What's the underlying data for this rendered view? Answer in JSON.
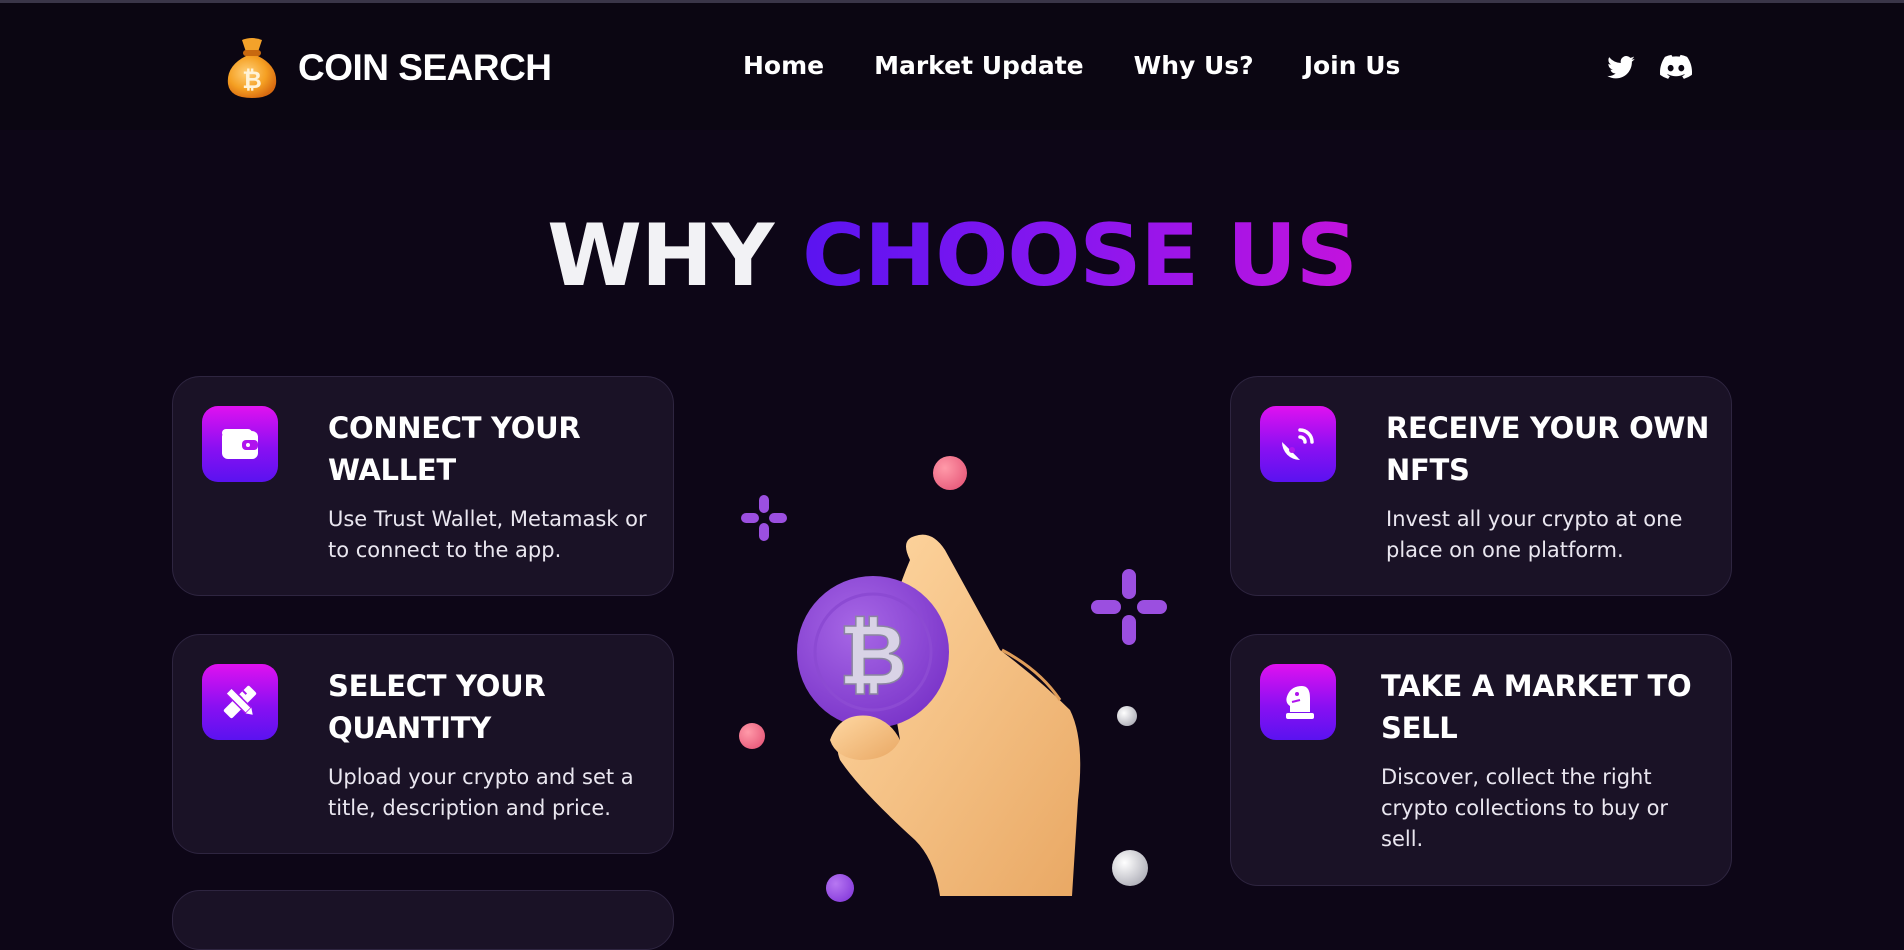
{
  "brand": {
    "name": "COIN SEARCH",
    "logo_icon": "bitcoin-money-bag-icon"
  },
  "nav": {
    "items": [
      "Home",
      "Market Update",
      "Why Us?",
      "Join Us"
    ]
  },
  "socials": {
    "twitter_icon": "twitter-icon",
    "discord_icon": "discord-icon"
  },
  "section": {
    "title_part1": "WHY",
    "title_part2": "CHOOSE US"
  },
  "features": [
    {
      "icon": "wallet-icon",
      "title": "CONNECT YOUR WALLET",
      "text": "Use Trust Wallet, Metamask or to connect to the app."
    },
    {
      "icon": "pencil-ruler-icon",
      "title": "SELECT YOUR QUANTITY",
      "text": "Upload your crypto and set a title, description and price."
    },
    {
      "icon": "satellite-dish-icon",
      "title": "RECEIVE YOUR OWN NFTS",
      "text": "Invest all your crypto at one place on one platform."
    },
    {
      "icon": "chess-knight-icon",
      "title": "TAKE A MARKET TO SELL",
      "text": "Discover, collect the right crypto collections to buy or sell."
    }
  ],
  "illustration": {
    "icon": "hand-holding-bitcoin-icon",
    "coin_symbol": "₿"
  },
  "colors": {
    "background": "#0d0617",
    "card": "#1a1226",
    "accent_start": "#5a14f0",
    "accent_end": "#c313dd"
  }
}
